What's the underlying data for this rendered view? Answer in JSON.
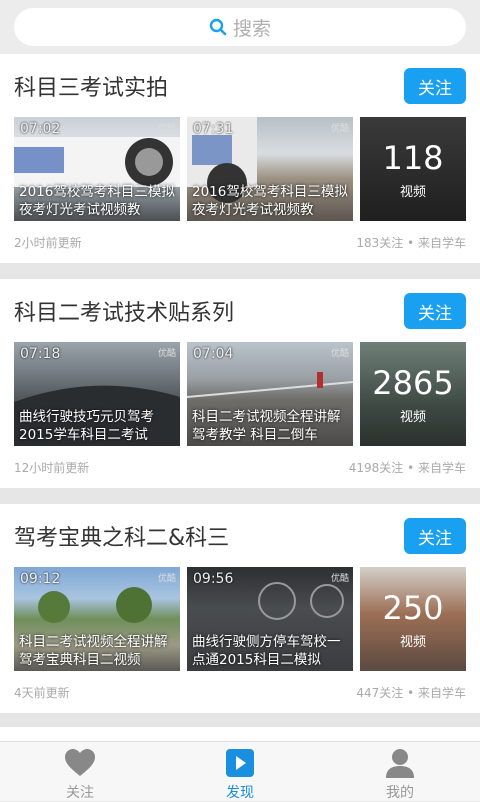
{
  "search": {
    "placeholder": "搜索",
    "icon": "search-icon"
  },
  "colors": {
    "accent": "#1aa0f0",
    "active_tab": "#1a8fe0"
  },
  "cards": [
    {
      "title": "科目三考试实拍",
      "follow": "关注",
      "videos": [
        {
          "duration": "07:02",
          "caption": "2016驾校驾考科目三模拟夜考灯光考试视频教"
        },
        {
          "duration": "07:31",
          "caption": "2016驾校驾考科目三模拟夜考灯光考试视频教"
        }
      ],
      "video_count": "118",
      "video_label": "视频",
      "updated": "2小时前更新",
      "stats": "183关注 • 来自学车"
    },
    {
      "title": "科目二考试技术贴系列",
      "follow": "关注",
      "videos": [
        {
          "duration": "07:18",
          "caption": "曲线行驶技巧元贝驾考2015学车科目二考试"
        },
        {
          "duration": "07:04",
          "caption": "科目二考试视频全程讲解驾考教学 科目二倒车"
        }
      ],
      "video_count": "2865",
      "video_label": "视频",
      "updated": "12小时前更新",
      "stats": "4198关注 • 来自学车"
    },
    {
      "title": "驾考宝典之科二&科三",
      "follow": "关注",
      "videos": [
        {
          "duration": "09:12",
          "caption": "科目二考试视频全程讲解驾考宝典科目二视频"
        },
        {
          "duration": "09:56",
          "caption": "曲线行驶侧方停车驾校一点通2015科目二模拟"
        }
      ],
      "video_count": "250",
      "video_label": "视频",
      "updated": "4天前更新",
      "stats": "447关注 • 来自学车"
    }
  ],
  "tabs": [
    {
      "label": "关注",
      "icon": "heart-icon"
    },
    {
      "label": "发现",
      "icon": "play-icon",
      "active": true
    },
    {
      "label": "我的",
      "icon": "user-icon"
    }
  ]
}
